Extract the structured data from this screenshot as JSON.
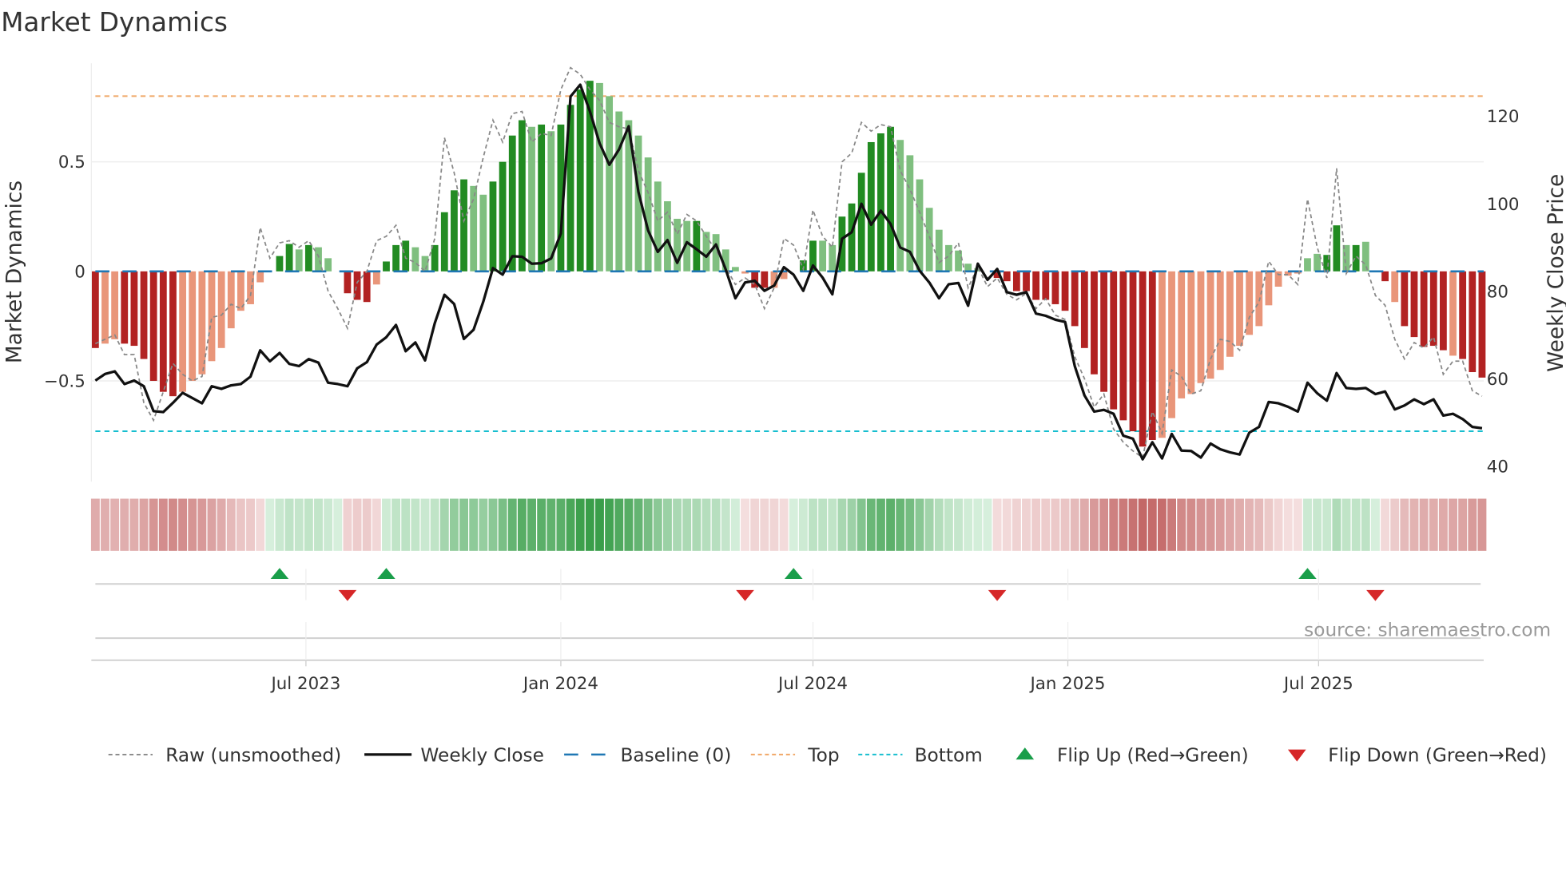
{
  "chart_data": {
    "type": "bar",
    "title": "Market Dynamics",
    "ylabel": "Market Dynamics",
    "y2label": "Weekly Close Price",
    "ylim": [
      -0.96,
      0.95
    ],
    "y2lim": [
      36.3,
      131.9
    ],
    "yticks": [
      {
        "v": 0.5,
        "label": "0.5"
      },
      {
        "v": 0,
        "label": "0"
      },
      {
        "v": -0.5,
        "label": "−0.5"
      }
    ],
    "y2ticks": [
      {
        "v": 120,
        "label": "120"
      },
      {
        "v": 100,
        "label": "100"
      },
      {
        "v": 80,
        "label": "80"
      },
      {
        "v": 60,
        "label": "60"
      },
      {
        "v": 40,
        "label": "40"
      }
    ],
    "xticks": [
      {
        "date": "2023-07-01",
        "label": "Jul 2023"
      },
      {
        "date": "2024-01-01",
        "label": "Jan 2024"
      },
      {
        "date": "2024-07-01",
        "label": "Jul 2024"
      },
      {
        "date": "2025-01-01",
        "label": "Jan 2025"
      },
      {
        "date": "2025-07-01",
        "label": "Jul 2025"
      }
    ],
    "start_date": "2023-01-30",
    "interval_days": 7,
    "top": 0.8,
    "bottom": -0.73,
    "baseline": 0,
    "values": [
      -0.35,
      -0.33,
      -0.31,
      -0.33,
      -0.34,
      -0.4,
      -0.5,
      -0.55,
      -0.57,
      -0.55,
      -0.5,
      -0.47,
      -0.41,
      -0.35,
      -0.26,
      -0.18,
      -0.15,
      -0.05,
      0,
      0.07,
      0.125,
      0.1,
      0.12,
      0.11,
      0.06,
      0,
      -0.1,
      -0.13,
      -0.14,
      -0.06,
      0.045,
      0.12,
      0.14,
      0.11,
      0.07,
      0.12,
      0.27,
      0.37,
      0.42,
      0.39,
      0.35,
      0.41,
      0.5,
      0.62,
      0.69,
      0.66,
      0.67,
      0.64,
      0.67,
      0.76,
      0.83,
      0.87,
      0.86,
      0.8,
      0.73,
      0.69,
      0.62,
      0.52,
      0.41,
      0.32,
      0.24,
      0.23,
      0.23,
      0.18,
      0.17,
      0.1,
      0.02,
      -0.01,
      -0.075,
      -0.075,
      -0.075,
      -0.035,
      0,
      0.05,
      0.14,
      0.14,
      0.12,
      0.25,
      0.31,
      0.45,
      0.59,
      0.63,
      0.66,
      0.6,
      0.53,
      0.42,
      0.29,
      0.19,
      0.12,
      0.095,
      0.035,
      0.015,
      0,
      -0.03,
      -0.045,
      -0.09,
      -0.09,
      -0.13,
      -0.13,
      -0.15,
      -0.18,
      -0.25,
      -0.35,
      -0.47,
      -0.55,
      -0.63,
      -0.68,
      -0.73,
      -0.8,
      -0.77,
      -0.76,
      -0.67,
      -0.58,
      -0.56,
      -0.51,
      -0.49,
      -0.45,
      -0.39,
      -0.34,
      -0.29,
      -0.25,
      -0.155,
      -0.07,
      -0.02,
      -0.01,
      0.06,
      0.08,
      0.075,
      0.21,
      0.12,
      0.12,
      0.135,
      0,
      -0.045,
      -0.14,
      -0.25,
      -0.3,
      -0.345,
      -0.34,
      -0.36,
      -0.385,
      -0.4,
      -0.46,
      -0.485
    ],
    "strong": "100111111000000000011010001110111001111001111010111100000000001000001100011001111110000000000111111111111111110000000000000000011010110111110111111",
    "raw": [
      -0.33,
      -0.31,
      -0.29,
      -0.38,
      -0.38,
      -0.6,
      -0.68,
      -0.55,
      -0.42,
      -0.47,
      -0.5,
      -0.48,
      -0.21,
      -0.2,
      -0.15,
      -0.17,
      -0.11,
      0.2,
      0.06,
      0.13,
      0.14,
      0.11,
      0.14,
      0.07,
      -0.09,
      -0.17,
      -0.26,
      -0.05,
      0.0,
      0.14,
      0.16,
      0.21,
      0.06,
      0.04,
      0.0,
      0.15,
      0.61,
      0.45,
      0.23,
      0.33,
      0.52,
      0.69,
      0.59,
      0.72,
      0.73,
      0.59,
      0.63,
      0.62,
      0.83,
      0.93,
      0.9,
      0.83,
      0.78,
      0.68,
      0.66,
      0.65,
      0.46,
      0.36,
      0.23,
      0.27,
      0.17,
      0.26,
      0.23,
      0.16,
      0.095,
      0.02,
      -0.06,
      -0.03,
      -0.06,
      -0.17,
      -0.075,
      0.15,
      0.12,
      0.01,
      0.28,
      0.16,
      0.11,
      0.5,
      0.54,
      0.68,
      0.64,
      0.67,
      0.66,
      0.46,
      0.375,
      0.27,
      0.16,
      0.04,
      0.07,
      0.13,
      -0.075,
      0.02,
      -0.07,
      -0.03,
      -0.105,
      -0.13,
      -0.1,
      -0.17,
      -0.125,
      -0.2,
      -0.22,
      -0.39,
      -0.49,
      -0.62,
      -0.56,
      -0.72,
      -0.78,
      -0.82,
      -0.85,
      -0.64,
      -0.74,
      -0.45,
      -0.48,
      -0.56,
      -0.545,
      -0.4,
      -0.31,
      -0.32,
      -0.36,
      -0.21,
      -0.14,
      0.046,
      -0.015,
      -0.015,
      -0.06,
      0.33,
      0.11,
      -0.03,
      0.47,
      -0.01,
      0.07,
      0.03,
      -0.11,
      -0.155,
      -0.31,
      -0.4,
      -0.325,
      -0.35,
      -0.3,
      -0.47,
      -0.41,
      -0.41,
      -0.545,
      -0.57
    ],
    "close": [
      59.4,
      60.9,
      61.5,
      58.6,
      59.4,
      58.1,
      52.4,
      52.2,
      54.3,
      56.6,
      55.4,
      54.2,
      58.1,
      57.5,
      58.3,
      58.6,
      60.3,
      66.3,
      63.8,
      65.7,
      63.2,
      62.7,
      64.3,
      63.5,
      58.9,
      58.6,
      58.1,
      62.2,
      63.6,
      67.6,
      69.3,
      72.1,
      66.1,
      68.1,
      64.0,
      72.5,
      79.0,
      76.9,
      68.9,
      71.0,
      77.4,
      85.1,
      83.6,
      87.8,
      87.7,
      86.1,
      86.2,
      87.3,
      93.0,
      124.3,
      127.0,
      120.9,
      113.6,
      108.7,
      112.2,
      117.5,
      102.5,
      93.7,
      88.8,
      91.5,
      86.3,
      91.0,
      89.4,
      87.7,
      90.5,
      84.8,
      78.2,
      81.8,
      82.2,
      79.9,
      81.1,
      85.3,
      83.6,
      79.9,
      85.7,
      82.9,
      79.1,
      91.8,
      93.3,
      99.8,
      95.0,
      98.2,
      95.2,
      89.8,
      88.8,
      84.5,
      81.8,
      78.2,
      81.4,
      81.7,
      76.5,
      86.1,
      82.4,
      84.9,
      79.6,
      79.0,
      79.6,
      74.7,
      74.2,
      73.3,
      72.8,
      62.7,
      56.0,
      52.3,
      52.7,
      51.8,
      46.8,
      46.1,
      41.4,
      45.3,
      41.6,
      47.2,
      43.4,
      43.3,
      41.8,
      45.0,
      43.7,
      43.0,
      42.5,
      47.5,
      48.8,
      54.5,
      54.2,
      53.4,
      52.3,
      58.9,
      56.5,
      54.8,
      61.1,
      57.7,
      57.5,
      57.7,
      56.3,
      56.9,
      52.8,
      53.7,
      55.1,
      54.0,
      55.1,
      51.4,
      51.8,
      50.6,
      48.8,
      48.5
    ],
    "flip_up": [
      "2023-06-12",
      "2023-08-28",
      "2024-06-17",
      "2025-06-23"
    ],
    "flip_down": [
      "2023-07-31",
      "2024-05-13",
      "2024-11-11",
      "2025-08-11"
    ],
    "legend": {
      "placement": "bottom",
      "items": [
        "Raw (unsmoothed)",
        "Weekly Close",
        "Baseline (0)",
        "Top",
        "Bottom",
        "Flip Up (Red→Green)",
        "Flip Down (Green→Red)"
      ]
    },
    "colors": {
      "pos_strong": "#228b22",
      "pos_weak": "#7fbf7f",
      "neg_strong": "#b22222",
      "neg_weak": "#e9967a",
      "raw": "#888888",
      "close": "#111111",
      "baseline": "#1f77b4",
      "top": "#f0a868",
      "bottom": "#17becf",
      "flip_up": "#1a9e4a",
      "flip_down": "#d62728"
    }
  },
  "source": "source: sharemaestro.com"
}
